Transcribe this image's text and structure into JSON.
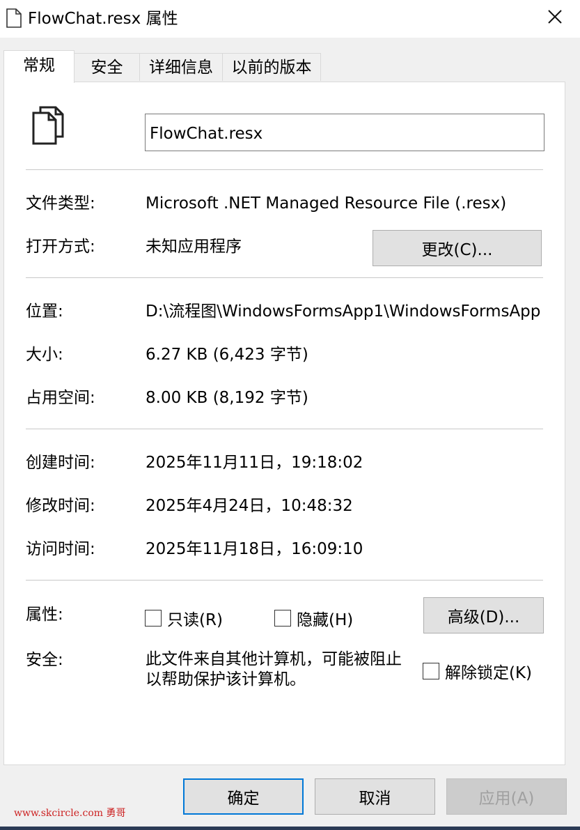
{
  "window": {
    "title": "FlowChat.resx 属性",
    "title_icon": "document-icon",
    "close_icon": "close-icon"
  },
  "tabs": [
    {
      "label": "常规",
      "active": true
    },
    {
      "label": "安全",
      "active": false
    },
    {
      "label": "详细信息",
      "active": false
    },
    {
      "label": "以前的版本",
      "active": false
    }
  ],
  "general": {
    "file_icon": "document-icon",
    "file_name": "FlowChat.resx",
    "type_label": "文件类型:",
    "type_value": "Microsoft .NET Managed Resource File (.resx)",
    "opens_label": "打开方式:",
    "opens_value": "未知应用程序",
    "change_button": "更改(C)...",
    "location_label": "位置:",
    "location_value": "D:\\流程图\\WindowsFormsApp1\\WindowsFormsApp",
    "size_label": "大小:",
    "size_value": "6.27 KB (6,423 字节)",
    "disk_label": "占用空间:",
    "disk_value": "8.00 KB (8,192 字节)",
    "created_label": "创建时间:",
    "created_value": "2025年11月11日，19:18:02",
    "modified_label": "修改时间:",
    "modified_value": "2025年4月24日，10:48:32",
    "accessed_label": "访问时间:",
    "accessed_value": "2025年11月18日，16:09:10",
    "attributes_label": "属性:",
    "readonly_label": "只读(R)",
    "readonly_checked": false,
    "hidden_label": "隐藏(H)",
    "hidden_checked": false,
    "advanced_button": "高级(D)...",
    "security_label": "安全:",
    "security_text": "此文件来自其他计算机，可能被阻止以帮助保护该计算机。",
    "unblock_label": "解除锁定(K)",
    "unblock_checked": false
  },
  "footer": {
    "ok_button": "确定",
    "cancel_button": "取消",
    "apply_button": "应用(A)",
    "watermark": "www.skcircle.com 勇哥"
  }
}
